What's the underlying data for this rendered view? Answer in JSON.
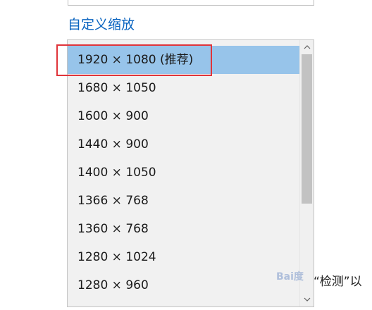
{
  "header": {
    "custom_scaling_link": "自定义缩放"
  },
  "resolution_list": {
    "selected_index": 0,
    "items": [
      "1920 × 1080 (推荐)",
      "1680 × 1050",
      "1600 × 900",
      "1440 × 900",
      "1400 × 1050",
      "1366 × 768",
      "1360 × 768",
      "1280 × 1024",
      "1280 × 960"
    ]
  },
  "background": {
    "partial_text": "“检测”以",
    "watermark": "Bai度"
  },
  "colors": {
    "selected_bg": "#97c4ea",
    "link": "#0a64c0",
    "highlight_box": "#e0343a"
  }
}
